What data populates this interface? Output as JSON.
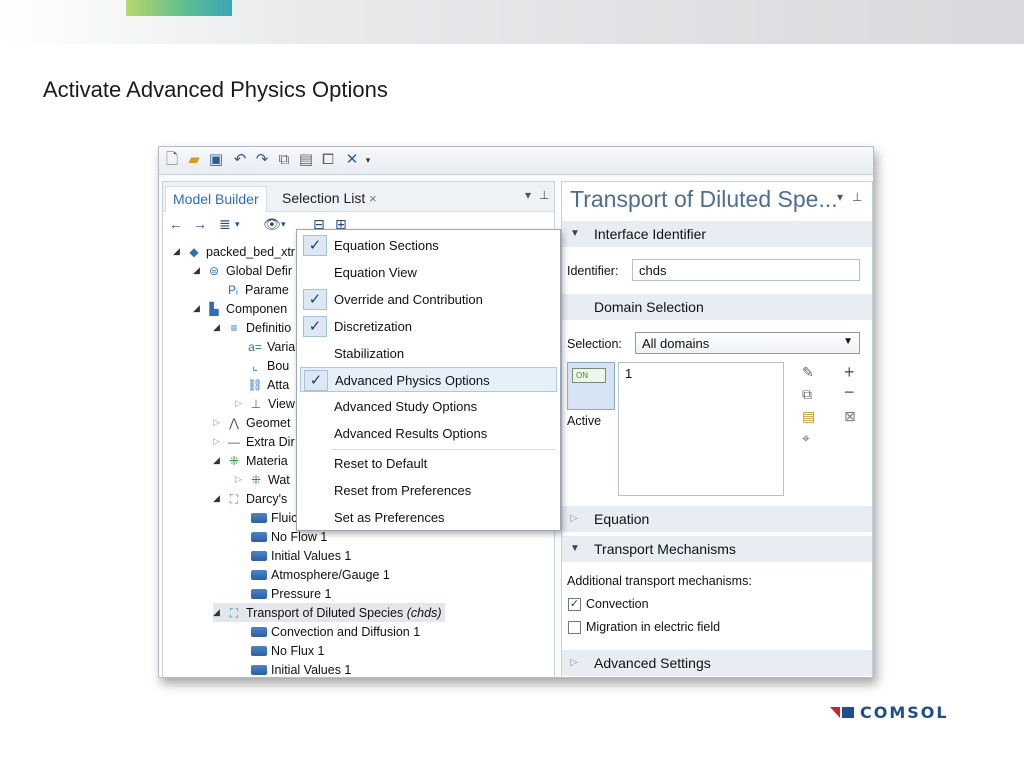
{
  "slide": {
    "title": "Activate Advanced Physics Options"
  },
  "toolbar": {
    "icons": [
      "new-file-icon",
      "open-folder-icon",
      "save-icon",
      "undo-icon",
      "redo-icon",
      "copy-icon",
      "paste-icon",
      "duplicate-icon",
      "delete-icon",
      "dropdown-arrow-icon"
    ]
  },
  "left_pane": {
    "tabs": [
      {
        "label": "Model Builder",
        "active": true
      },
      {
        "label": "Selection List",
        "closable": true
      }
    ],
    "close_glyph": "×",
    "tree": [
      {
        "label": "packed_bed_xtr",
        "level": 0,
        "icon": "model-icon"
      },
      {
        "label": "Global Defir",
        "level": 1,
        "icon": "global-definitions-icon"
      },
      {
        "label": "Parame",
        "level": 2,
        "icon": "parameters-icon"
      },
      {
        "label": "Componen",
        "level": 1,
        "icon": "component-icon"
      },
      {
        "label": "Definitio",
        "level": 2,
        "icon": "definitions-icon"
      },
      {
        "label": "Varia",
        "level": 3,
        "icon": "variables-icon"
      },
      {
        "label": "Bou",
        "level": 3,
        "icon": "boundary-system-icon"
      },
      {
        "label": "Atta",
        "level": 3,
        "icon": "attach-icon"
      },
      {
        "label": "View",
        "level": 3,
        "icon": "view-icon"
      },
      {
        "label": "Geomet",
        "level": 2,
        "icon": "geometry-icon"
      },
      {
        "label": "Extra Dir",
        "level": 2,
        "icon": "extra-dimension-icon"
      },
      {
        "label": "Materia",
        "level": 2,
        "icon": "materials-icon"
      },
      {
        "label": "Wat",
        "level": 3,
        "icon": "material-icon"
      },
      {
        "label": "Darcy's",
        "level": 2,
        "icon": "darcy-physics-icon"
      },
      {
        "label": "Fluic",
        "level": 3,
        "icon": "boundary-condition-icon"
      },
      {
        "label": "No Flow 1",
        "level": 3,
        "icon": "boundary-condition-icon"
      },
      {
        "label": "Initial Values 1",
        "level": 3,
        "icon": "boundary-condition-icon"
      },
      {
        "label": "Atmosphere/Gauge 1",
        "level": 3,
        "icon": "boundary-condition-icon"
      },
      {
        "label": "Pressure 1",
        "level": 3,
        "icon": "boundary-condition-icon"
      },
      {
        "label": "Transport of Diluted Species",
        "tag": "(chds)",
        "level": 2,
        "icon": "transport-physics-icon",
        "selected": true
      },
      {
        "label": "Convection and Diffusion 1",
        "level": 3,
        "icon": "boundary-condition-icon"
      },
      {
        "label": "No Flux 1",
        "level": 3,
        "icon": "boundary-condition-icon"
      },
      {
        "label": "Initial Values 1",
        "level": 3,
        "icon": "boundary-condition-icon"
      }
    ]
  },
  "menu": {
    "items": [
      {
        "label": "Equation Sections",
        "checked": true
      },
      {
        "label": "Equation View",
        "checked": false
      },
      {
        "label": "Override and Contribution",
        "checked": true
      },
      {
        "label": "Discretization",
        "checked": true
      },
      {
        "label": "Stabilization",
        "checked": false
      },
      {
        "label": "Advanced Physics Options",
        "checked": true,
        "highlighted": true
      },
      {
        "label": "Advanced Study Options",
        "checked": false
      },
      {
        "label": "Advanced Results Options",
        "checked": false
      },
      {
        "label": "Reset to Default",
        "checked": false
      },
      {
        "label": "Reset from Preferences",
        "checked": false
      },
      {
        "label": "Set as Preferences",
        "checked": false
      }
    ],
    "check_glyph": "✓"
  },
  "right_pane": {
    "title": "Transport of Diluted Spe...",
    "interface_identifier": {
      "section": "Interface Identifier",
      "label": "Identifier:",
      "value": "chds"
    },
    "domain_selection": {
      "section": "Domain Selection",
      "label": "Selection:",
      "value": "All domains",
      "list_value": "1",
      "toggle_text": "ON",
      "active_label": "Active"
    },
    "equation": {
      "section": "Equation"
    },
    "transport_mechanisms": {
      "section": "Transport Mechanisms",
      "label": "Additional transport mechanisms:",
      "convection": {
        "label": "Convection",
        "checked": true
      },
      "migration": {
        "label": "Migration in electric field",
        "checked": false
      }
    },
    "advanced_settings": {
      "section": "Advanced Settings"
    }
  },
  "footer": {
    "brand": "COMSOL",
    "colors": {
      "mark_red": "#d2232a",
      "mark_blue": "#1f4f8a"
    }
  }
}
